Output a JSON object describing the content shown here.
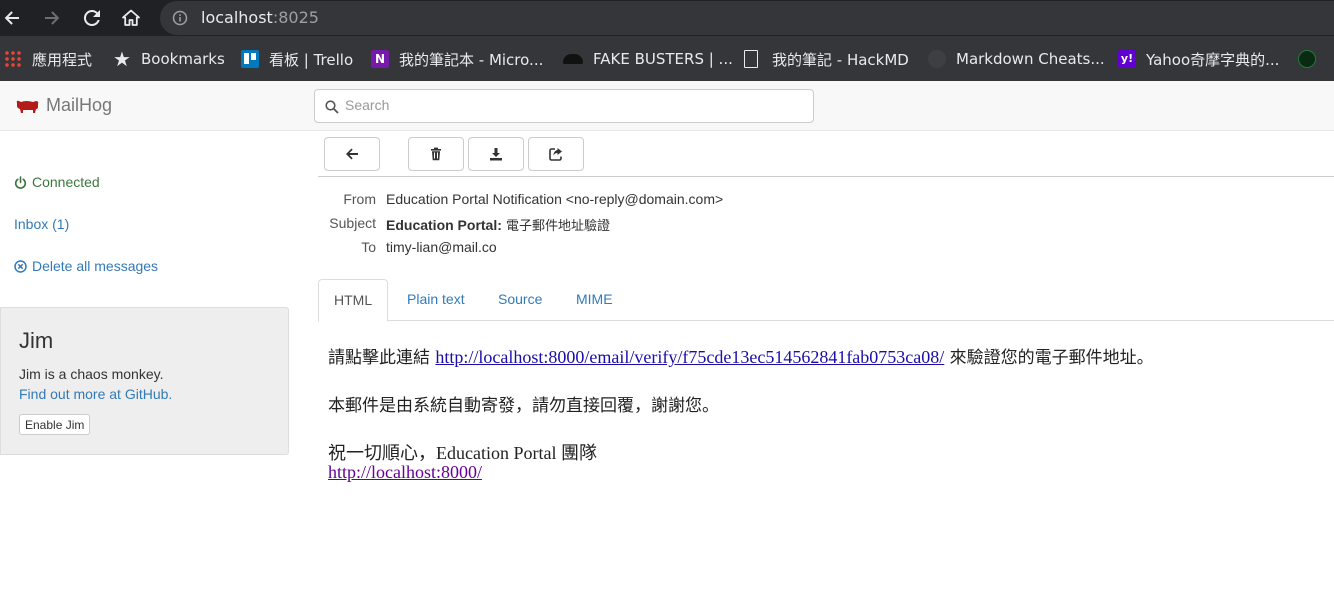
{
  "browser": {
    "url_host": "localhost",
    "url_port": ":8025",
    "bookmarks": [
      {
        "label": "應用程式",
        "icon": "apps-grid-icon",
        "color": "#ea4335"
      },
      {
        "label": "Bookmarks",
        "icon": "star-icon",
        "color": "#e8eaed"
      },
      {
        "label": "看板 | Trello",
        "icon": "trello-icon",
        "color": "#0079bf"
      },
      {
        "label": "我的筆記本 - Micro...",
        "icon": "onenote-icon",
        "color": "#7719aa"
      },
      {
        "label": "FAKE BUSTERS | ...",
        "icon": "fake-busters-icon",
        "color": "#111111"
      },
      {
        "label": "我的筆記 - HackMD",
        "icon": "document-icon",
        "color": "#e8eaed"
      },
      {
        "label": "Markdown Cheats...",
        "icon": "github-icon",
        "color": "#e8eaed"
      },
      {
        "label": "Yahoo奇摩字典的...",
        "icon": "yahoo-icon",
        "color": "#6001d2"
      }
    ]
  },
  "app": {
    "brand": "MailHog",
    "search_placeholder": "Search"
  },
  "sidebar": {
    "connected": "Connected",
    "inbox": "Inbox (1)",
    "delete_all": "Delete all messages"
  },
  "jim": {
    "title": "Jim",
    "description": "Jim is a chaos monkey.",
    "link": "Find out more at GitHub.",
    "button": "Enable Jim"
  },
  "message": {
    "from_label": "From",
    "from": "Education Portal Notification <no-reply@domain.com>",
    "subject_label": "Subject",
    "subject_bold": "Education Portal:",
    "subject_rest": " 電子郵件地址驗證",
    "to_label": "To",
    "to": "timy-lian@mail.co"
  },
  "tabs": [
    "HTML",
    "Plain text",
    "Source",
    "MIME"
  ],
  "body": {
    "line1_before": "請點擊此連結 ",
    "verify_link": "http://localhost:8000/email/verify/f75cde13ec514562841fab0753ca08/",
    "line1_after": " 來驗證您的電子郵件地址。",
    "line2": "本郵件是由系統自動寄發，請勿直接回覆，謝謝您。",
    "line3": "祝一切順心，Education Portal 團隊",
    "home_link": "http://localhost:8000/"
  }
}
